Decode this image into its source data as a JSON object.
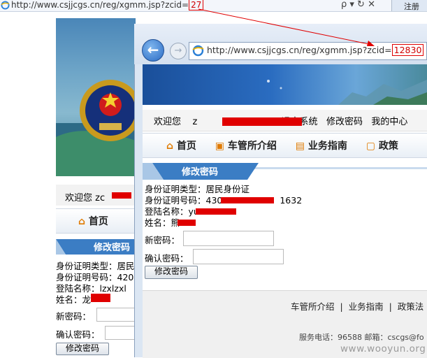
{
  "back_window": {
    "address_bar": {
      "url_prefix": "http://www.csjjcgs.cn/reg/xgmm.jsp?zcid=",
      "url_zcid": "27",
      "controls": "ρ ▾ ↻ ✕"
    },
    "tab": {
      "label": "注册"
    },
    "welcome_text": "欢迎您  zc",
    "nav": {
      "home": "首页"
    },
    "panel_title": "修改密码",
    "form": {
      "id_type": "身份证明类型：居民",
      "id_number": "身份证明号码：420",
      "login_name": "登陆名称：lzxlzxl",
      "name": "姓名：龙",
      "new_password_label": "新密码：",
      "confirm_password_label": "确认密码：",
      "submit_label": "修改密码"
    }
  },
  "front_window": {
    "address_bar": {
      "url_prefix": "http://www.csjjcgs.cn/reg/xgmm.jsp?zcid=",
      "url_zcid": "12830"
    },
    "header": {
      "welcome": "欢迎您",
      "user_prefix": "z",
      "logout_text": "退出系统",
      "change_password": "修改密码",
      "my_center": "我的中心"
    },
    "nav": {
      "items": [
        "首页",
        "车管所介绍",
        "业务指南",
        "政策"
      ]
    },
    "panel_title": "修改密码",
    "form": {
      "id_type": "身份证明类型：居民身份证",
      "id_number_prefix": "身份证明号码：430",
      "id_number_suffix": "1632",
      "login_name_prefix": "登陆名称：yu",
      "name_prefix": "姓名：熊",
      "new_password_label": "新密码：",
      "confirm_password_label": "确认密码：",
      "submit_label": "修改密码"
    },
    "footer": {
      "links": [
        "车管所介绍",
        "业务指南",
        "政策法"
      ],
      "service_phone": "服务电话：96588",
      "email_label": "邮箱：cscgs@fo"
    }
  },
  "watermark": "www.wooyun.org",
  "colors": {
    "redaction": "#e00000",
    "highlight_box": "#e00000",
    "panel_title_bg": "#3b7dc4",
    "brand_blue": "#2a6cc0"
  },
  "icons": {
    "browser": "ie-icon",
    "back": "back-arrow-icon",
    "forward": "forward-arrow-icon",
    "home": "home-icon",
    "car": "car-office-icon",
    "guide": "guide-book-icon",
    "policy": "policy-icon"
  }
}
